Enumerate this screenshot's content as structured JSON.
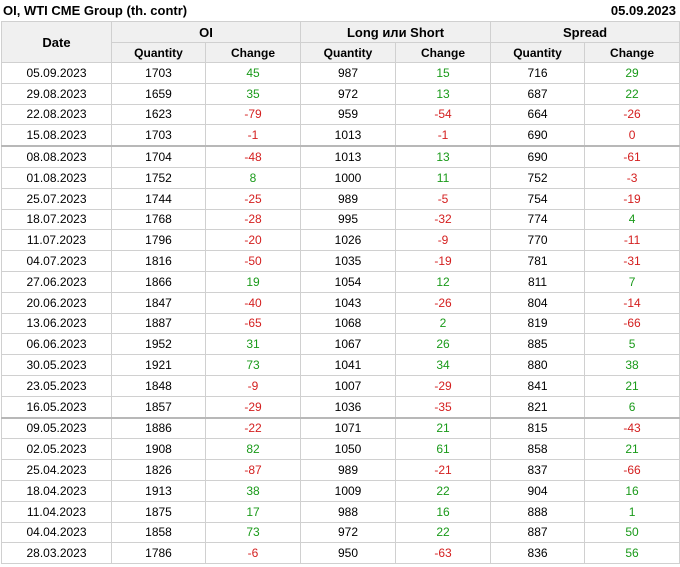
{
  "header": {
    "title": "OI, WTI CME Group (th. contr)",
    "date": "05.09.2023"
  },
  "table": {
    "date_col": "Date",
    "groups": [
      "OI",
      "Long или Short",
      "Spread"
    ],
    "sub": [
      "Quantity",
      "Change"
    ],
    "colors": {
      "positive": "#1a9a1a",
      "negative": "#d42020"
    },
    "separator_after_rows": [
      3,
      16
    ],
    "rows": [
      [
        "05.09.2023",
        "1703",
        "45",
        "987",
        "15",
        "716",
        "29"
      ],
      [
        "29.08.2023",
        "1659",
        "35",
        "972",
        "13",
        "687",
        "22"
      ],
      [
        "22.08.2023",
        "1623",
        "-79",
        "959",
        "-54",
        "664",
        "-26"
      ],
      [
        "15.08.2023",
        "1703",
        "-1",
        "1013",
        "-1",
        "690",
        "0"
      ],
      [
        "08.08.2023",
        "1704",
        "-48",
        "1013",
        "13",
        "690",
        "-61"
      ],
      [
        "01.08.2023",
        "1752",
        "8",
        "1000",
        "11",
        "752",
        "-3"
      ],
      [
        "25.07.2023",
        "1744",
        "-25",
        "989",
        "-5",
        "754",
        "-19"
      ],
      [
        "18.07.2023",
        "1768",
        "-28",
        "995",
        "-32",
        "774",
        "4"
      ],
      [
        "11.07.2023",
        "1796",
        "-20",
        "1026",
        "-9",
        "770",
        "-11"
      ],
      [
        "04.07.2023",
        "1816",
        "-50",
        "1035",
        "-19",
        "781",
        "-31"
      ],
      [
        "27.06.2023",
        "1866",
        "19",
        "1054",
        "12",
        "811",
        "7"
      ],
      [
        "20.06.2023",
        "1847",
        "-40",
        "1043",
        "-26",
        "804",
        "-14"
      ],
      [
        "13.06.2023",
        "1887",
        "-65",
        "1068",
        "2",
        "819",
        "-66"
      ],
      [
        "06.06.2023",
        "1952",
        "31",
        "1067",
        "26",
        "885",
        "5"
      ],
      [
        "30.05.2023",
        "1921",
        "73",
        "1041",
        "34",
        "880",
        "38"
      ],
      [
        "23.05.2023",
        "1848",
        "-9",
        "1007",
        "-29",
        "841",
        "21"
      ],
      [
        "16.05.2023",
        "1857",
        "-29",
        "1036",
        "-35",
        "821",
        "6"
      ],
      [
        "09.05.2023",
        "1886",
        "-22",
        "1071",
        "21",
        "815",
        "-43"
      ],
      [
        "02.05.2023",
        "1908",
        "82",
        "1050",
        "61",
        "858",
        "21"
      ],
      [
        "25.04.2023",
        "1826",
        "-87",
        "989",
        "-21",
        "837",
        "-66"
      ],
      [
        "18.04.2023",
        "1913",
        "38",
        "1009",
        "22",
        "904",
        "16"
      ],
      [
        "11.04.2023",
        "1875",
        "17",
        "988",
        "16",
        "888",
        "1"
      ],
      [
        "04.04.2023",
        "1858",
        "73",
        "972",
        "22",
        "887",
        "50"
      ],
      [
        "28.03.2023",
        "1786",
        "-6",
        "950",
        "-63",
        "836",
        "56"
      ]
    ]
  }
}
